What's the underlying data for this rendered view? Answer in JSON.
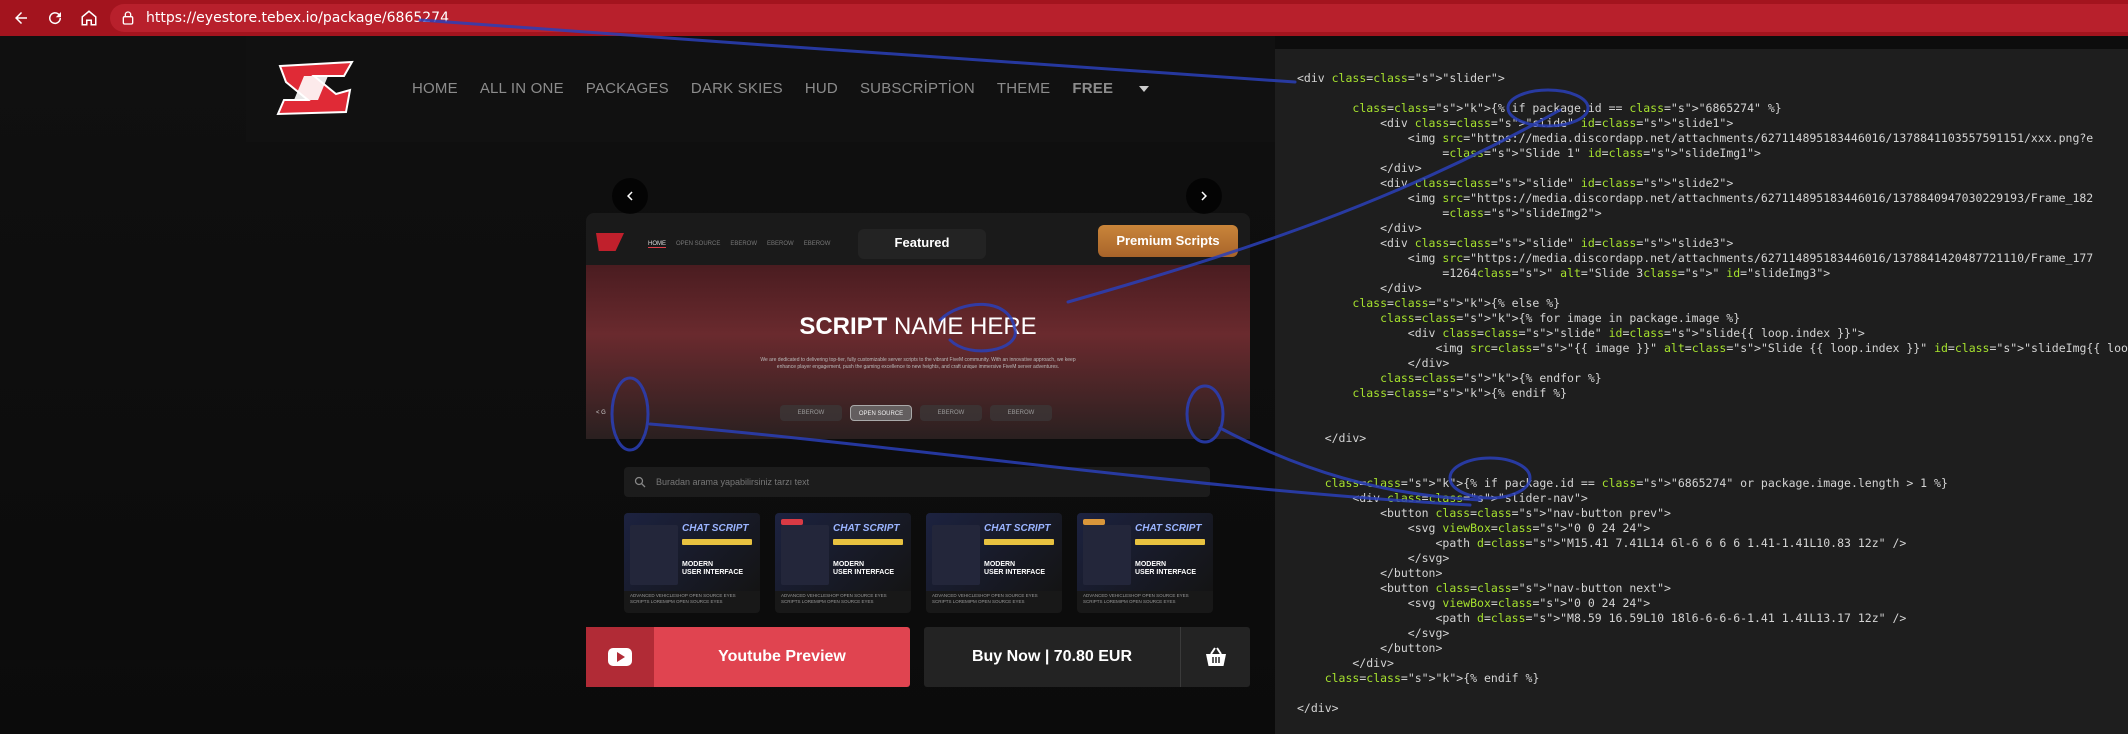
{
  "browser": {
    "url": "https://eyestore.tebex.io/package/6865274"
  },
  "site": {
    "menu": [
      "HOME",
      "ALL IN ONE",
      "PACKAGES",
      "DARK SKIES",
      "HUD",
      "SUBSCRİPTİON",
      "THEME",
      "FREE"
    ],
    "slide": {
      "mini_menu": [
        "HOME",
        "OPEN SOURCE",
        "EBEROW",
        "EBEROW",
        "EBEROW"
      ],
      "featured_label": "Featured",
      "premium_label": "Premium Scripts",
      "hero_title_bold": "SCRIPT",
      "hero_title_rest": " NAME HERE",
      "hero_desc": "We are dedicated to delivering top-tier, fully customizable server scripts to the vibrant FiveM community. With an innovative approach, we keep enhance player engagement, push the gaming excellence to new heights, and craft unique immersive FiveM server adventures.",
      "tabs": [
        "EBEROW",
        "OPEN SOURCE",
        "EBEROW",
        "EBEROW"
      ],
      "selected_tab": 1,
      "prev_label": "< G"
    },
    "search_placeholder": "Buradan arama yapabilirsiniz tarzı text",
    "cards": [
      {
        "title": "CHAT SCRIPT",
        "ui": "MODERN\nUSER INTERFACE",
        "footer": "ADVANCED VEHICLESHOP OPEN SOURCE EYES SCRIPTS LOREMIPM OPEN SOURCE EYES",
        "tag_color": ""
      },
      {
        "title": "CHAT SCRIPT",
        "ui": "MODERN\nUSER INTERFACE",
        "footer": "ADVANCED VEHICLESHOP OPEN SOURCE EYES SCRIPTS LOREMIPM OPEN SOURCE EYES",
        "tag_color": "#d93a44"
      },
      {
        "title": "CHAT SCRIPT",
        "ui": "MODERN\nUSER INTERFACE",
        "footer": "ADVANCED VEHICLESHOP OPEN SOURCE EYES SCRIPTS LOREMIPM OPEN SOURCE EYES",
        "tag_color": ""
      },
      {
        "title": "CHAT SCRIPT",
        "ui": "MODERN\nUSER INTERFACE",
        "footer": "ADVANCED VEHICLESHOP OPEN SOURCE EYES SCRIPTS LOREMIPM OPEN SOURCE EYES",
        "tag_color": "#d9963a"
      }
    ],
    "youtube_label": "Youtube Preview",
    "buy_label": "Buy Now | 70.80 EUR"
  },
  "code": [
    "<div class=\"slider\">",
    "",
    "        {% if package.id == \"6865274\" %}",
    "            <div class=\"slide\" id=\"slide1\">",
    "                <img src=\"https://media.discordapp.net/attachments/627114895183446016/1378841103557591151/xxx.png?e",
    "                     =\"Slide 1\" id=\"slideImg1\">",
    "            </div>",
    "            <div class=\"slide\" id=\"slide2\">",
    "                <img src=\"https://media.discordapp.net/attachments/627114895183446016/1378840947030229193/Frame_182",
    "                     =\"slideImg2\">",
    "            </div>",
    "            <div class=\"slide\" id=\"slide3\">",
    "                <img src=\"https://media.discordapp.net/attachments/627114895183446016/1378841420487721110/Frame_177",
    "                     =1264\" alt=\"Slide 3\" id=\"slideImg3\">",
    "            </div>",
    "        {% else %}",
    "            {% for image in package.image %}",
    "                <div class=\"slide\" id=\"slide{{ loop.index }}\">",
    "                    <img src=\"{{ image }}\" alt=\"Slide {{ loop.index }}\" id=\"slideImg{{ loop.index }}\">",
    "                </div>",
    "            {% endfor %}",
    "        {% endif %}",
    "",
    "",
    "    </div>",
    "",
    "",
    "    {% if package.id == \"6865274\" or package.image.length > 1 %}",
    "        <div class=\"slider-nav\">",
    "            <button class=\"nav-button prev\">",
    "                <svg viewBox=\"0 0 24 24\">",
    "                    <path d=\"M15.41 7.41L14 6l-6 6 6 6 1.41-1.41L10.83 12z\" />",
    "                </svg>",
    "            </button>",
    "            <button class=\"nav-button next\">",
    "                <svg viewBox=\"0 0 24 24\">",
    "                    <path d=\"M8.59 16.59L10 18l6-6-6-6-1.41 1.41L13.17 12z\" />",
    "                </svg>",
    "            </button>",
    "        </div>",
    "    {% endif %}",
    "",
    "</div>"
  ]
}
